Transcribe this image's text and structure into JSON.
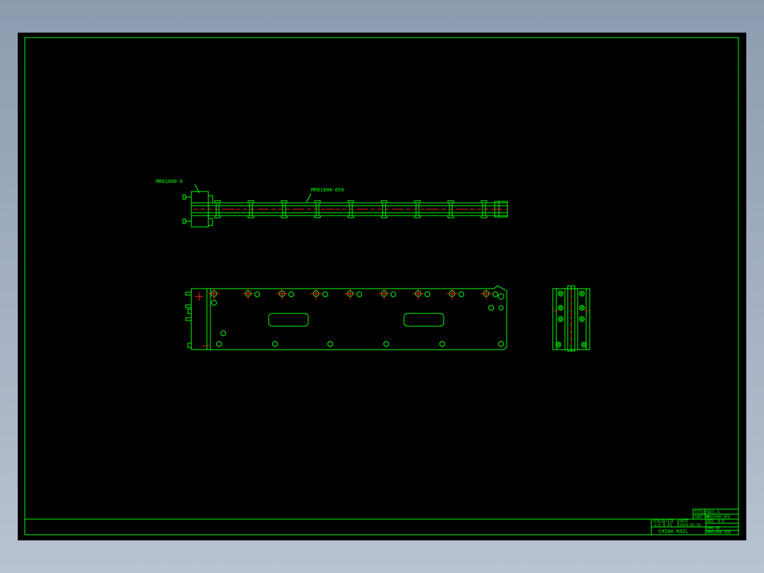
{
  "colors": {
    "background": "#000000",
    "linework": "#00ff00",
    "centerline": "#ff2020",
    "desktop": "#a6b1c3"
  },
  "callouts": {
    "left_part": "MR01000-0",
    "rail_part": "MR01000-050"
  },
  "title_block": {
    "row1_title": "TITLE",
    "row1_value": "RAIL-A",
    "row2_title": "PART NO",
    "row2_value": "MR01000-050",
    "scale_label": "SCALE",
    "scale_value": "1/5",
    "size_label": "SIZE",
    "size_value": "A3",
    "date_label": "DATE",
    "date_value": "2014.02.01",
    "company": "CHINA RAIL",
    "dwg_label": "DWG NO",
    "dwg_value": "MR01000-050",
    "rev_label": "REV",
    "rev_value": "A-0"
  }
}
